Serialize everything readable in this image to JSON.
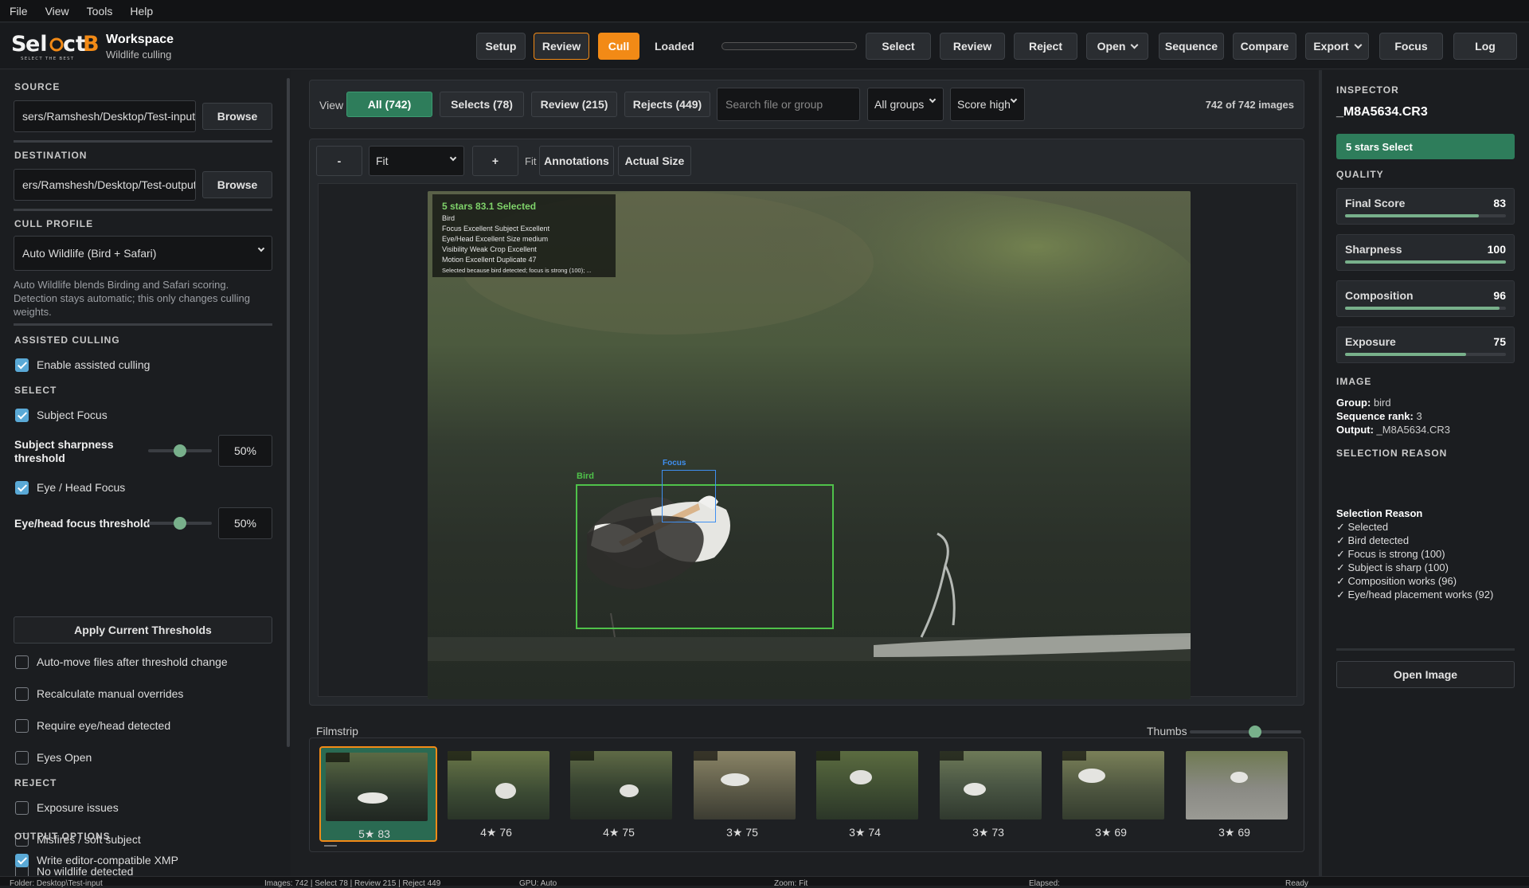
{
  "menu": [
    "File",
    "View",
    "Tools",
    "Help"
  ],
  "brand": {
    "logo_text": "SelectB",
    "tagline": "SELECT THE BEST",
    "title": "Workspace",
    "subtitle": "Wildlife culling"
  },
  "toolbar": {
    "steps": [
      "Setup",
      "Review",
      "Cull"
    ],
    "status": "Loaded",
    "progress": 0,
    "actions": [
      "Select",
      "Review",
      "Reject",
      "Open",
      "Sequence",
      "Compare",
      "Export",
      "Focus",
      "Log"
    ]
  },
  "left": {
    "source_label": "SOURCE",
    "source_value": "sers/Ramshesh/Desktop/Test-input",
    "destination_label": "DESTINATION",
    "destination_value": "ers/Ramshesh/Desktop/Test-output",
    "browse": "Browse",
    "cull_profile_label": "CULL PROFILE",
    "cull_profile_value": "Auto Wildlife (Bird + Safari)",
    "profile_note": "Auto Wildlife blends Birding and Safari scoring. Detection stays automatic; this only changes culling weights.",
    "assisted_label": "ASSISTED CULLING",
    "enable_assisted": "Enable assisted culling",
    "select_label": "SELECT",
    "subject_focus": "Subject Focus",
    "subject_sharpness": "Subject sharpness threshold",
    "subject_sharpness_value": "50%",
    "eye_head_focus": "Eye / Head Focus",
    "eye_head_threshold": "Eye/head focus threshold",
    "eye_head_threshold_value": "50%",
    "apply": "Apply Current Thresholds",
    "auto_move": "Auto-move files after threshold change",
    "recalc": "Recalculate manual overrides",
    "require_eye": "Require eye/head detected",
    "eyes_open": "Eyes Open",
    "reject_label": "REJECT",
    "exposure": "Exposure issues",
    "misfires": "Misfires / soft subject",
    "no_wildlife": "No wildlife detected",
    "output_label": "OUTPUT OPTIONS",
    "write_xmp": "Write editor-compatible XMP"
  },
  "view": {
    "label": "View",
    "tabs": [
      "All (742)",
      "Selects (78)",
      "Review (215)",
      "Rejects (449)"
    ],
    "search_placeholder": "Search file or group",
    "groups": "All groups",
    "sort": "Score high",
    "count": "742 of 742 images"
  },
  "zoom": {
    "minus": "-",
    "fit": "Fit",
    "plus": "+",
    "fit_label": "Fit",
    "annotations": "Annotations",
    "actual": "Actual Size"
  },
  "overlay": {
    "header": "5 stars   83.1   Selected",
    "lines": [
      "Bird",
      "Focus Excellent   Subject Excellent",
      "Eye/Head Excellent   Size medium",
      "Visibility Weak   Crop Excellent",
      "Motion Excellent   Duplicate 47",
      "Selected because bird detected; focus is strong (100); ..."
    ],
    "bird_label": "Bird",
    "focus_label": "Focus"
  },
  "filmstrip": {
    "label": "Filmstrip",
    "thumbs_label": "Thumbs",
    "thumbs_level": 0.6,
    "items": [
      {
        "caption": "5★  83"
      },
      {
        "caption": "4★  76"
      },
      {
        "caption": "4★  75"
      },
      {
        "caption": "3★  75"
      },
      {
        "caption": "3★  74"
      },
      {
        "caption": "3★  73"
      },
      {
        "caption": "3★  69"
      },
      {
        "caption": "3★  69"
      }
    ]
  },
  "inspector": {
    "label": "INSPECTOR",
    "file": "_M8A5634.CR3",
    "badge": "5 stars  Select",
    "quality_label": "QUALITY",
    "scores": [
      {
        "name": "Final Score",
        "value": 83
      },
      {
        "name": "Sharpness",
        "value": 100
      },
      {
        "name": "Composition",
        "value": 96
      },
      {
        "name": "Exposure",
        "value": 75
      }
    ],
    "image_label": "IMAGE",
    "group_k": "Group:",
    "group_v": " bird",
    "rank_k": "Sequence rank:",
    "rank_v": " 3",
    "output_k": "Output:",
    "output_v": " _M8A5634.CR3",
    "reason_label": "SELECTION REASON",
    "reason_title": "Selection Reason",
    "reasons": [
      "✓ Selected",
      "✓ Bird detected",
      "✓ Focus is strong (100)",
      "✓ Subject is sharp (100)",
      "✓ Composition works (96)",
      "✓ Eye/head placement works (92)"
    ],
    "open": "Open Image"
  },
  "status": {
    "folder": "Folder: Desktop\\Test-input",
    "counts": "Images: 742 | Select 78 | Review 215 | Reject 449",
    "gpu": "GPU: Auto",
    "zoom": "Zoom: Fit",
    "elapsed": "Elapsed:",
    "ready": "Ready"
  },
  "colors": {
    "accent": "#f28a16",
    "select_green": "#2e7d5b",
    "bar": "#78b08b"
  }
}
